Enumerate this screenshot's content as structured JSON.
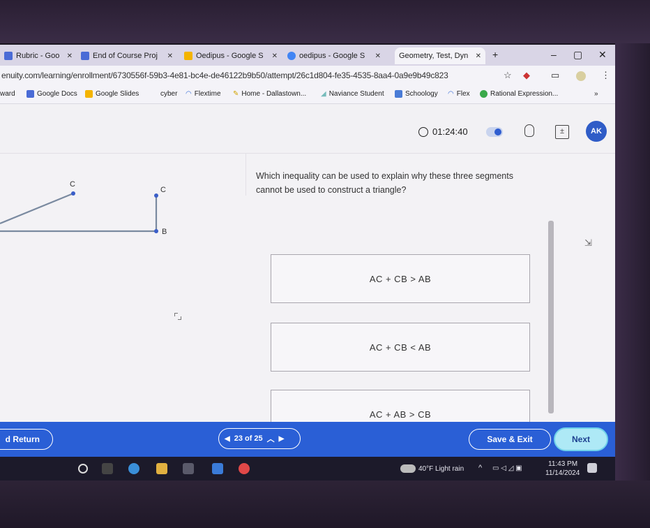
{
  "browser": {
    "tabs": [
      {
        "label": "Rubric - Goo",
        "favicon_color": "#4a6bd6"
      },
      {
        "label": "End of Course Proj",
        "favicon_color": "#4a6bd6"
      },
      {
        "label": "Oedipus - Google S",
        "favicon_color": "#f4b400"
      },
      {
        "label": "oedipus - Google S",
        "favicon_color": "#4285f4"
      },
      {
        "label": "Geometry, Test, Dyn",
        "favicon_color": "#cfd3e0",
        "active": true
      }
    ],
    "new_tab": "+",
    "window_controls": {
      "minimize": "–",
      "maximize": "▢",
      "close": "✕"
    },
    "url": "enuity.com/learning/enrollment/6730556f-59b3-4e81-bc4e-de46122b9b50/attempt/26c1d804-fe35-4535-8aa4-0a9e9b49c823",
    "bookmarks": [
      {
        "label": "ward",
        "color": "#888"
      },
      {
        "label": "Google Docs",
        "color": "#4a6bd6"
      },
      {
        "label": "Google Slides",
        "color": "#f4b400"
      },
      {
        "label": "cyber",
        "color": "#777"
      },
      {
        "label": "Flextime",
        "color": "#3b6fd8"
      },
      {
        "label": "Home - Dallastown...",
        "color": "#d2a400"
      },
      {
        "label": "Naviance Student",
        "color": "#8cc"
      },
      {
        "label": "Schoology",
        "color": "#4a7bd6"
      },
      {
        "label": "Flex",
        "color": "#3b6fd8"
      },
      {
        "label": "Rational Expression...",
        "color": "#3aa84a"
      }
    ],
    "bookmarks_more": "»"
  },
  "header": {
    "timer": "01:24:40",
    "avatar_initials": "AK",
    "accent_color": "#2f5cc7"
  },
  "diagram": {
    "labels": {
      "left_c": "C",
      "right_c": "C",
      "right_b": "B"
    }
  },
  "question": {
    "text": "Which inequality can be used to explain why these three segments cannot be used to construct a triangle?",
    "choices": [
      {
        "text": "AC + CB > AB"
      },
      {
        "text": "AC + CB < AB"
      },
      {
        "text": "AC + AB > CB"
      }
    ]
  },
  "footer": {
    "return_label": "d Return",
    "pager": "23 of 25",
    "save_exit_label": "Save & Exit",
    "next_label": "Next"
  },
  "taskbar": {
    "weather": "40°F  Light rain",
    "time": "11:43 PM",
    "date": "11/14/2024"
  }
}
